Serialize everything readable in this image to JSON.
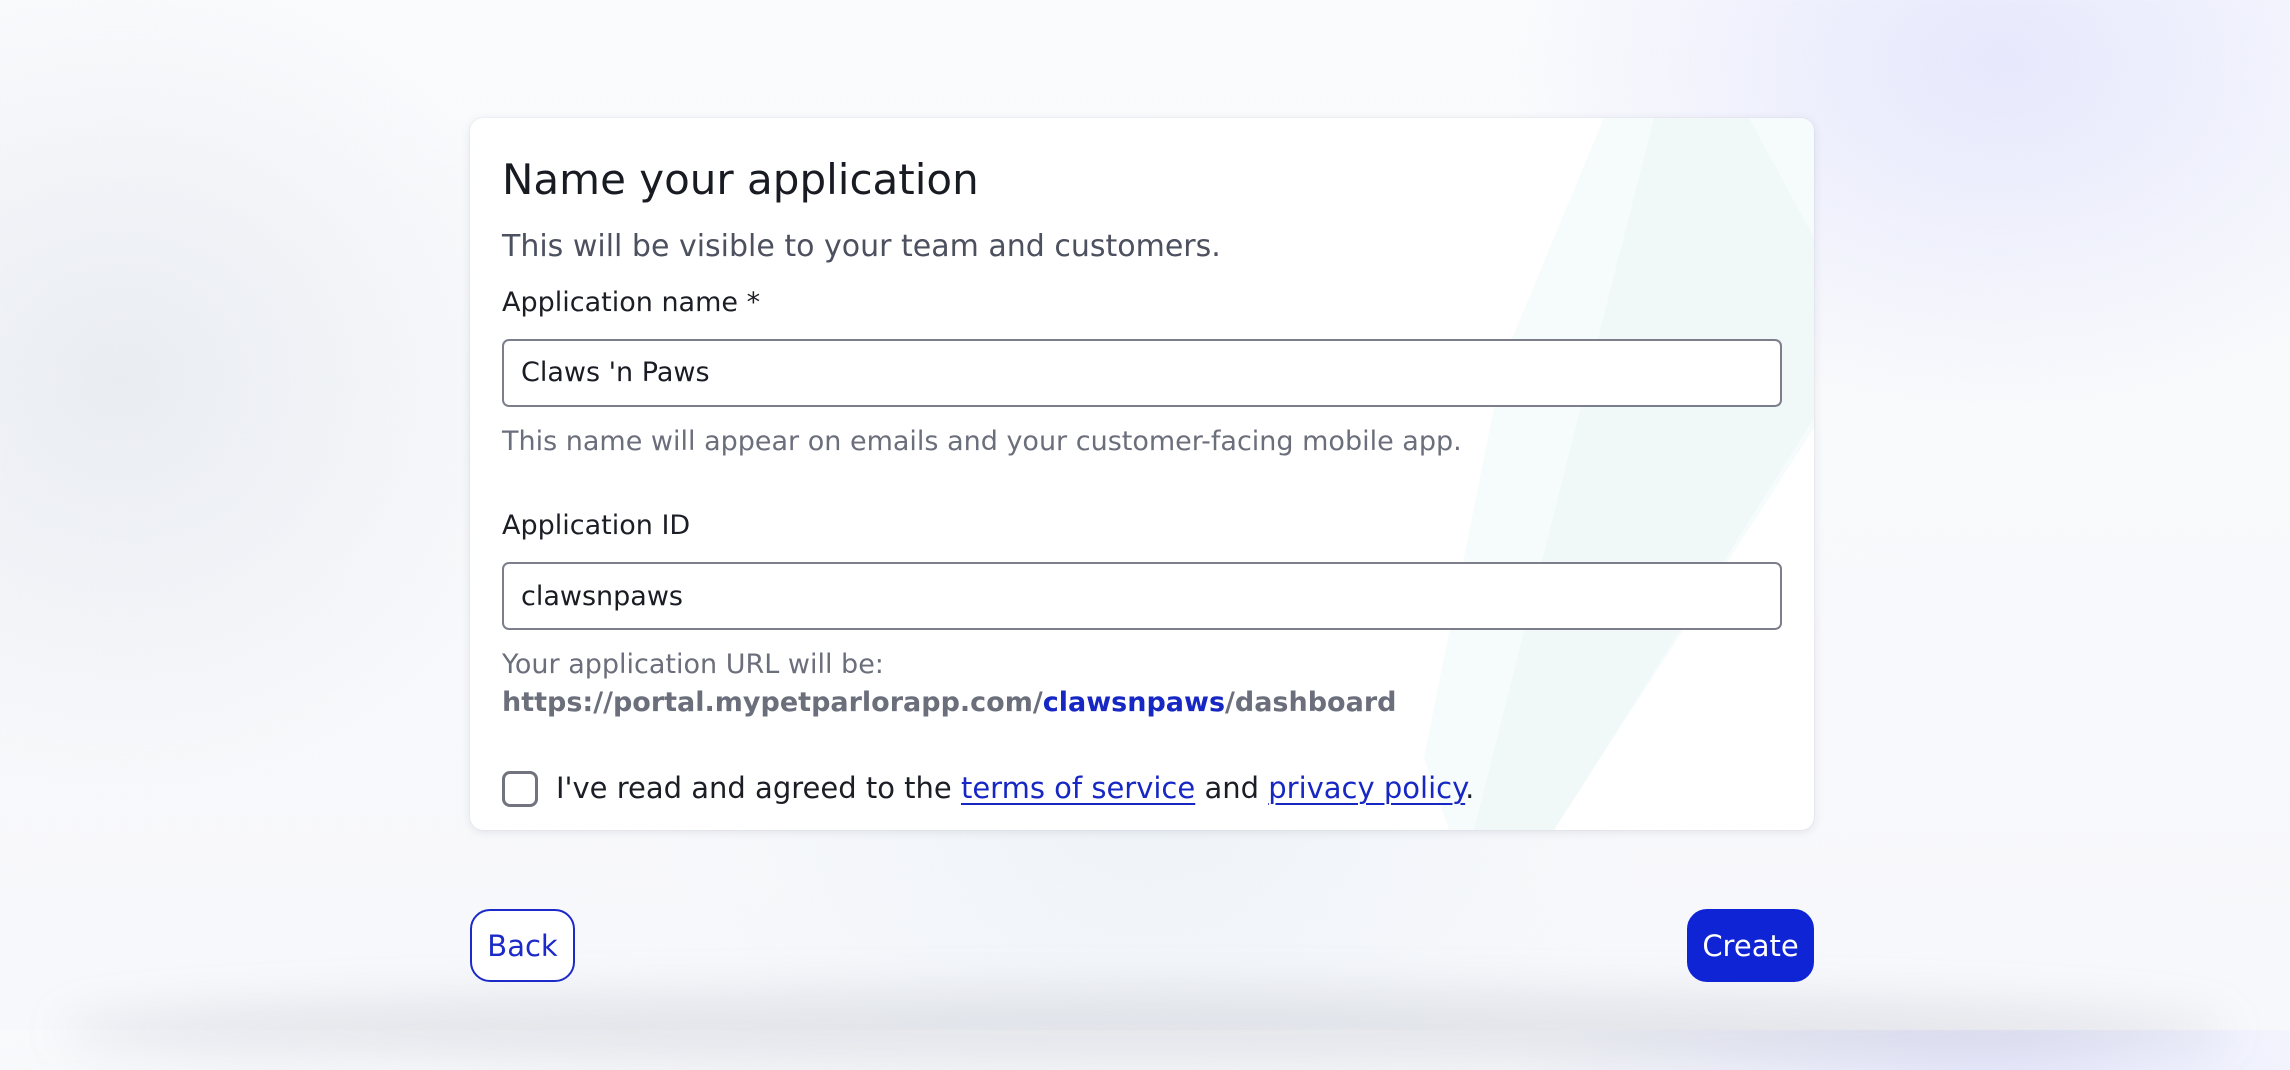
{
  "colors": {
    "accent": "#0f24d4",
    "link": "#1727c4",
    "text_primary": "#191b23",
    "text_muted": "#6b6e7b",
    "input_border": "#7c7f8b"
  },
  "form": {
    "title": "Name your application",
    "subtitle": "This will be visible to your team and customers.",
    "app_name": {
      "label": "Application name *",
      "value": "Claws 'n Paws",
      "help": "This name will appear on emails and your customer-facing mobile app."
    },
    "app_id": {
      "label": "Application ID",
      "value": "clawsnpaws",
      "help_prefix": "Your application URL will be:",
      "url_base": "https://portal.mypetparlorapp.com/",
      "url_slug": "clawsnpaws",
      "url_suffix": "/dashboard"
    },
    "agreement": {
      "text_before": "I've read and agreed to the",
      "terms_link": "terms of service",
      "text_middle": "and",
      "privacy_link": "privacy policy",
      "text_after": "."
    }
  },
  "actions": {
    "back_label": "Back",
    "create_label": "Create"
  }
}
